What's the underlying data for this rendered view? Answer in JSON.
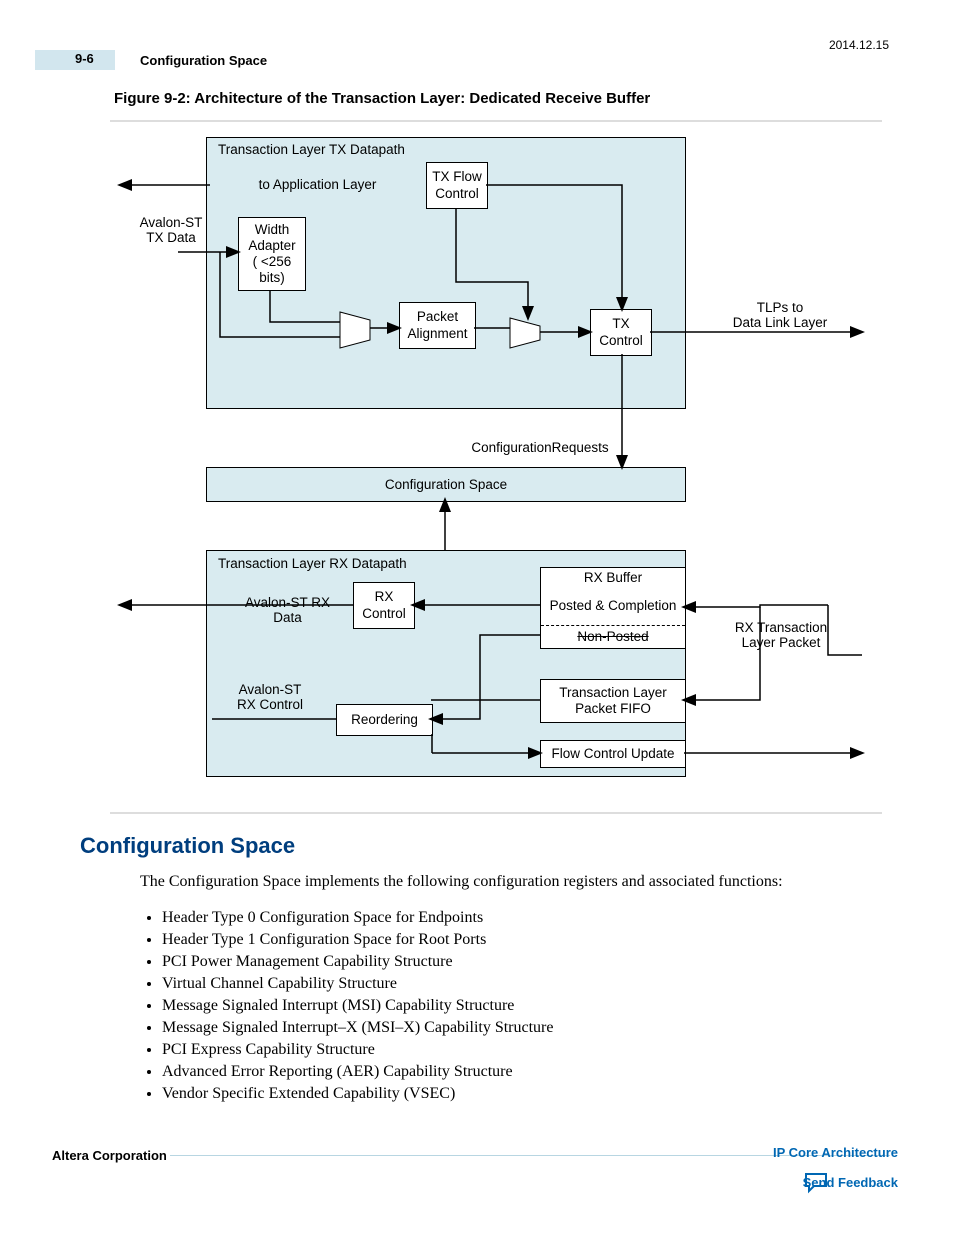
{
  "header": {
    "page_num": "9-6",
    "title": "Configuration Space",
    "date": "2014.12.15"
  },
  "figure": {
    "title": "Figure 9-2: Architecture of the Transaction Layer: Dedicated Receive Buffer"
  },
  "diagram": {
    "tx_title": "Transaction Layer TX Datapath",
    "to_app": "to Application Layer",
    "avalon_tx_data": "Avalon-ST\nTX Data",
    "width_adapter": "Width\nAdapter\n( <256\nbits)",
    "tx_flow": "TX Flow\nControl",
    "packet_alignment": "Packet\nAlignment",
    "tx_control": "TX\nControl",
    "tlps_to": "TLPs to\nData Link Layer",
    "config_requests": "ConfigurationRequests",
    "config_space": "Configuration Space",
    "rx_title": "Transaction Layer RX Datapath",
    "avalon_rx_data": "Avalon-ST RX Data",
    "rx_control": "RX\nControl",
    "rx_buffer": "RX Buffer",
    "posted_completion": "Posted & Completion",
    "non_posted": "Non-Posted",
    "rx_txn_packet": "RX Transaction\nLayer Packet",
    "avalon_rx_ctrl": "Avalon-ST\nRX Control",
    "reordering": "Reordering",
    "tl_packet_fifo": "Transaction Layer\nPacket FIFO",
    "flow_control_update": "Flow Control Update"
  },
  "section": {
    "heading": "Configuration Space",
    "intro": "The Configuration Space implements the following configuration registers and associated functions:",
    "items": [
      "Header Type 0 Configuration Space for Endpoints",
      "Header Type 1 Configuration Space for Root Ports",
      "PCI Power Management Capability Structure",
      "Virtual Channel Capability Structure",
      "Message Signaled Interrupt (MSI) Capability Structure",
      "Message Signaled Interrupt–X (MSI–X) Capability Structure",
      "PCI Express Capability Structure",
      "Advanced Error Reporting (AER) Capability Structure",
      "Vendor Specific Extended Capability (VSEC)"
    ]
  },
  "footer": {
    "left": "Altera Corporation",
    "right_top": "IP Core Architecture",
    "right_bot": "Send Feedback"
  }
}
